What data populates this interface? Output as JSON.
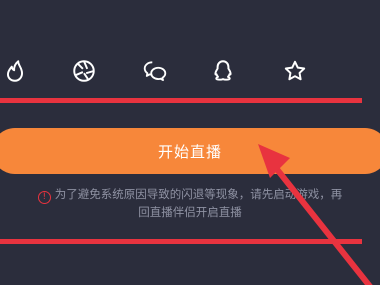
{
  "share_icons": [
    {
      "name": "flame-icon"
    },
    {
      "name": "aperture-icon"
    },
    {
      "name": "wechat-icon"
    },
    {
      "name": "qq-icon"
    },
    {
      "name": "star-icon"
    }
  ],
  "start_button": {
    "label": "开始直播"
  },
  "notice": {
    "line1": "为了避免系统原因导致的闪退等现象，请先启动游戏，再",
    "line2": "回直播伴侣开启直播"
  },
  "colors": {
    "background": "#2b2d3c",
    "accent": "#f7873a",
    "annotation": "#e8333f",
    "notice_text": "#8f92a3"
  }
}
